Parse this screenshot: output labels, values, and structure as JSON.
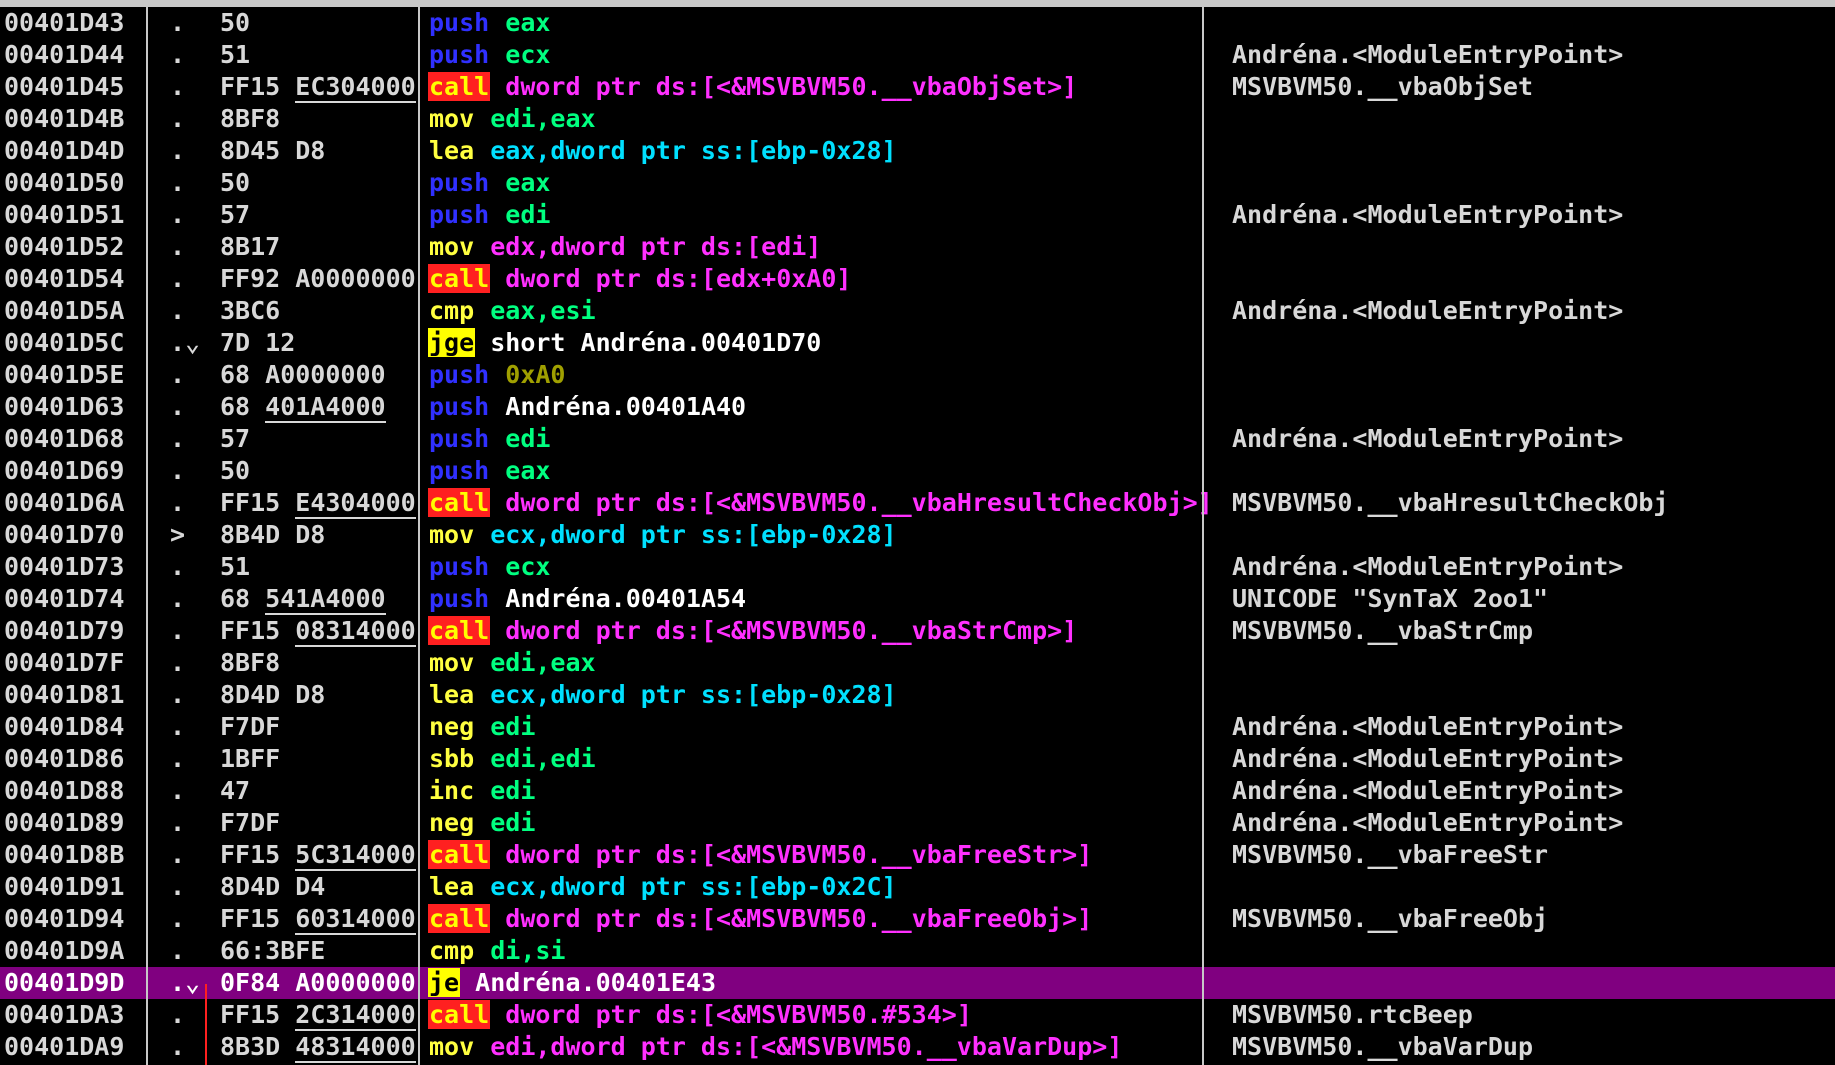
{
  "colors": {
    "background": "#000000",
    "push": "#3030ff",
    "call_bg": "#ff2020",
    "jcc_bg": "#ffff00",
    "selected_row": "#800080",
    "operand_magenta": "#ff30ff",
    "operand_cyan": "#00e0ff",
    "operand_green": "#00ff80"
  },
  "rows": [
    {
      "addr": "00401D43",
      "mark": ".",
      "hex": "50",
      "hex_ul": false,
      "mnem": "push",
      "mclass": "m-push",
      "ops": "eax",
      "oclass": "o-green",
      "comment": ""
    },
    {
      "addr": "00401D44",
      "mark": ".",
      "hex": "51",
      "hex_ul": false,
      "mnem": "push",
      "mclass": "m-push",
      "ops": "ecx",
      "oclass": "o-green",
      "comment": "Andréna.<ModuleEntryPoint>"
    },
    {
      "addr": "00401D45",
      "mark": ".",
      "hex": "FF15 EC304000",
      "hex_ul": true,
      "mnem": "call",
      "mclass": "m-call",
      "ops": "dword ptr ds:[<&MSVBVM50.__vbaObjSet>]",
      "oclass": "o-default",
      "comment": "MSVBVM50.__vbaObjSet"
    },
    {
      "addr": "00401D4B",
      "mark": ".",
      "hex": "8BF8",
      "hex_ul": false,
      "mnem": "mov",
      "mclass": "m-plain",
      "ops": "edi,eax",
      "oclass": "o-green",
      "comment": ""
    },
    {
      "addr": "00401D4D",
      "mark": ".",
      "hex": "8D45 D8",
      "hex_ul": false,
      "mnem": "lea",
      "mclass": "m-plain",
      "ops": "eax,dword ptr ss:[ebp-0x28]",
      "oclass": "o-cyan",
      "comment": ""
    },
    {
      "addr": "00401D50",
      "mark": ".",
      "hex": "50",
      "hex_ul": false,
      "mnem": "push",
      "mclass": "m-push",
      "ops": "eax",
      "oclass": "o-green",
      "comment": ""
    },
    {
      "addr": "00401D51",
      "mark": ".",
      "hex": "57",
      "hex_ul": false,
      "mnem": "push",
      "mclass": "m-push",
      "ops": "edi",
      "oclass": "o-green",
      "comment": "Andréna.<ModuleEntryPoint>"
    },
    {
      "addr": "00401D52",
      "mark": ".",
      "hex": "8B17",
      "hex_ul": false,
      "mnem": "mov",
      "mclass": "m-plain",
      "ops": "edx,dword ptr ds:[edi]",
      "oclass": "o-default",
      "comment": ""
    },
    {
      "addr": "00401D54",
      "mark": ".",
      "hex": "FF92 A0000000",
      "hex_ul": false,
      "mnem": "call",
      "mclass": "m-call",
      "ops": "dword ptr ds:[edx+0xA0]",
      "oclass": "o-default",
      "comment": ""
    },
    {
      "addr": "00401D5A",
      "mark": ".",
      "hex": "3BC6",
      "hex_ul": false,
      "mnem": "cmp",
      "mclass": "m-plain",
      "ops": "eax,esi",
      "oclass": "o-green",
      "comment": "Andréna.<ModuleEntryPoint>"
    },
    {
      "addr": "00401D5C",
      "mark": ".⌄",
      "hex": "7D 12",
      "hex_ul": false,
      "mnem": "jge",
      "mclass": "m-jcc",
      "ops": "short Andréna.00401D70",
      "oclass": "o-white",
      "comment": ""
    },
    {
      "addr": "00401D5E",
      "mark": ".",
      "hex": "68 A0000000",
      "hex_ul": false,
      "mnem": "push",
      "mclass": "m-push",
      "ops": "0xA0",
      "oclass": "o-olive",
      "comment": ""
    },
    {
      "addr": "00401D63",
      "mark": ".",
      "hex": "68 401A4000",
      "hex_ul": true,
      "mnem": "push",
      "mclass": "m-push",
      "ops": "Andréna.00401A40",
      "oclass": "o-white",
      "comment": ""
    },
    {
      "addr": "00401D68",
      "mark": ".",
      "hex": "57",
      "hex_ul": false,
      "mnem": "push",
      "mclass": "m-push",
      "ops": "edi",
      "oclass": "o-green",
      "comment": "Andréna.<ModuleEntryPoint>"
    },
    {
      "addr": "00401D69",
      "mark": ".",
      "hex": "50",
      "hex_ul": false,
      "mnem": "push",
      "mclass": "m-push",
      "ops": "eax",
      "oclass": "o-green",
      "comment": ""
    },
    {
      "addr": "00401D6A",
      "mark": ".",
      "hex": "FF15 E4304000",
      "hex_ul": true,
      "mnem": "call",
      "mclass": "m-call",
      "ops": "dword ptr ds:[<&MSVBVM50.__vbaHresultCheckObj>]",
      "oclass": "o-default",
      "comment": "MSVBVM50.__vbaHresultCheckObj"
    },
    {
      "addr": "00401D70",
      "mark": ">",
      "hex": "8B4D D8",
      "hex_ul": false,
      "mnem": "mov",
      "mclass": "m-plain",
      "ops": "ecx,dword ptr ss:[ebp-0x28]",
      "oclass": "o-cyan",
      "comment": ""
    },
    {
      "addr": "00401D73",
      "mark": ".",
      "hex": "51",
      "hex_ul": false,
      "mnem": "push",
      "mclass": "m-push",
      "ops": "ecx",
      "oclass": "o-green",
      "comment": "Andréna.<ModuleEntryPoint>"
    },
    {
      "addr": "00401D74",
      "mark": ".",
      "hex": "68 541A4000",
      "hex_ul": true,
      "mnem": "push",
      "mclass": "m-push",
      "ops": "Andréna.00401A54",
      "oclass": "o-white",
      "comment": "UNICODE \"SynTaX 2oo1\""
    },
    {
      "addr": "00401D79",
      "mark": ".",
      "hex": "FF15 08314000",
      "hex_ul": true,
      "mnem": "call",
      "mclass": "m-call",
      "ops": "dword ptr ds:[<&MSVBVM50.__vbaStrCmp>]",
      "oclass": "o-default",
      "comment": "MSVBVM50.__vbaStrCmp"
    },
    {
      "addr": "00401D7F",
      "mark": ".",
      "hex": "8BF8",
      "hex_ul": false,
      "mnem": "mov",
      "mclass": "m-plain",
      "ops": "edi,eax",
      "oclass": "o-green",
      "comment": ""
    },
    {
      "addr": "00401D81",
      "mark": ".",
      "hex": "8D4D D8",
      "hex_ul": false,
      "mnem": "lea",
      "mclass": "m-plain",
      "ops": "ecx,dword ptr ss:[ebp-0x28]",
      "oclass": "o-cyan",
      "comment": ""
    },
    {
      "addr": "00401D84",
      "mark": ".",
      "hex": "F7DF",
      "hex_ul": false,
      "mnem": "neg",
      "mclass": "m-plain",
      "ops": "edi",
      "oclass": "o-green",
      "comment": "Andréna.<ModuleEntryPoint>"
    },
    {
      "addr": "00401D86",
      "mark": ".",
      "hex": "1BFF",
      "hex_ul": false,
      "mnem": "sbb",
      "mclass": "m-plain",
      "ops": "edi,edi",
      "oclass": "o-green",
      "comment": "Andréna.<ModuleEntryPoint>"
    },
    {
      "addr": "00401D88",
      "mark": ".",
      "hex": "47",
      "hex_ul": false,
      "mnem": "inc",
      "mclass": "m-plain",
      "ops": "edi",
      "oclass": "o-green",
      "comment": "Andréna.<ModuleEntryPoint>"
    },
    {
      "addr": "00401D89",
      "mark": ".",
      "hex": "F7DF",
      "hex_ul": false,
      "mnem": "neg",
      "mclass": "m-plain",
      "ops": "edi",
      "oclass": "o-green",
      "comment": "Andréna.<ModuleEntryPoint>"
    },
    {
      "addr": "00401D8B",
      "mark": ".",
      "hex": "FF15 5C314000",
      "hex_ul": true,
      "mnem": "call",
      "mclass": "m-call",
      "ops": "dword ptr ds:[<&MSVBVM50.__vbaFreeStr>]",
      "oclass": "o-default",
      "comment": "MSVBVM50.__vbaFreeStr"
    },
    {
      "addr": "00401D91",
      "mark": ".",
      "hex": "8D4D D4",
      "hex_ul": false,
      "mnem": "lea",
      "mclass": "m-plain",
      "ops": "ecx,dword ptr ss:[ebp-0x2C]",
      "oclass": "o-cyan",
      "comment": ""
    },
    {
      "addr": "00401D94",
      "mark": ".",
      "hex": "FF15 60314000",
      "hex_ul": true,
      "mnem": "call",
      "mclass": "m-call",
      "ops": "dword ptr ds:[<&MSVBVM50.__vbaFreeObj>]",
      "oclass": "o-default",
      "comment": "MSVBVM50.__vbaFreeObj"
    },
    {
      "addr": "00401D9A",
      "mark": ".",
      "hex": "66:3BFE",
      "hex_ul": false,
      "mnem": "cmp",
      "mclass": "m-plain",
      "ops": "di,si",
      "oclass": "o-green",
      "comment": ""
    },
    {
      "addr": "00401D9D",
      "mark": ".⌄",
      "hex": "0F84 A0000000",
      "hex_ul": false,
      "mnem": "je",
      "mclass": "m-jcc",
      "ops": "Andréna.00401E43",
      "oclass": "o-white",
      "comment": "",
      "selected": true
    },
    {
      "addr": "00401DA3",
      "mark": ".",
      "hex": "FF15 2C314000",
      "hex_ul": true,
      "mnem": "call",
      "mclass": "m-call",
      "ops": "dword ptr ds:[<&MSVBVM50.#534>]",
      "oclass": "o-default",
      "comment": "MSVBVM50.rtcBeep"
    },
    {
      "addr": "00401DA9",
      "mark": ".",
      "hex": "8B3D 48314000",
      "hex_ul": true,
      "mnem": "mov",
      "mclass": "m-plain",
      "ops": "edi,dword ptr ds:[<&MSVBVM50.__vbaVarDup>]",
      "oclass": "o-default",
      "comment": "MSVBVM50.__vbaVarDup"
    }
  ]
}
